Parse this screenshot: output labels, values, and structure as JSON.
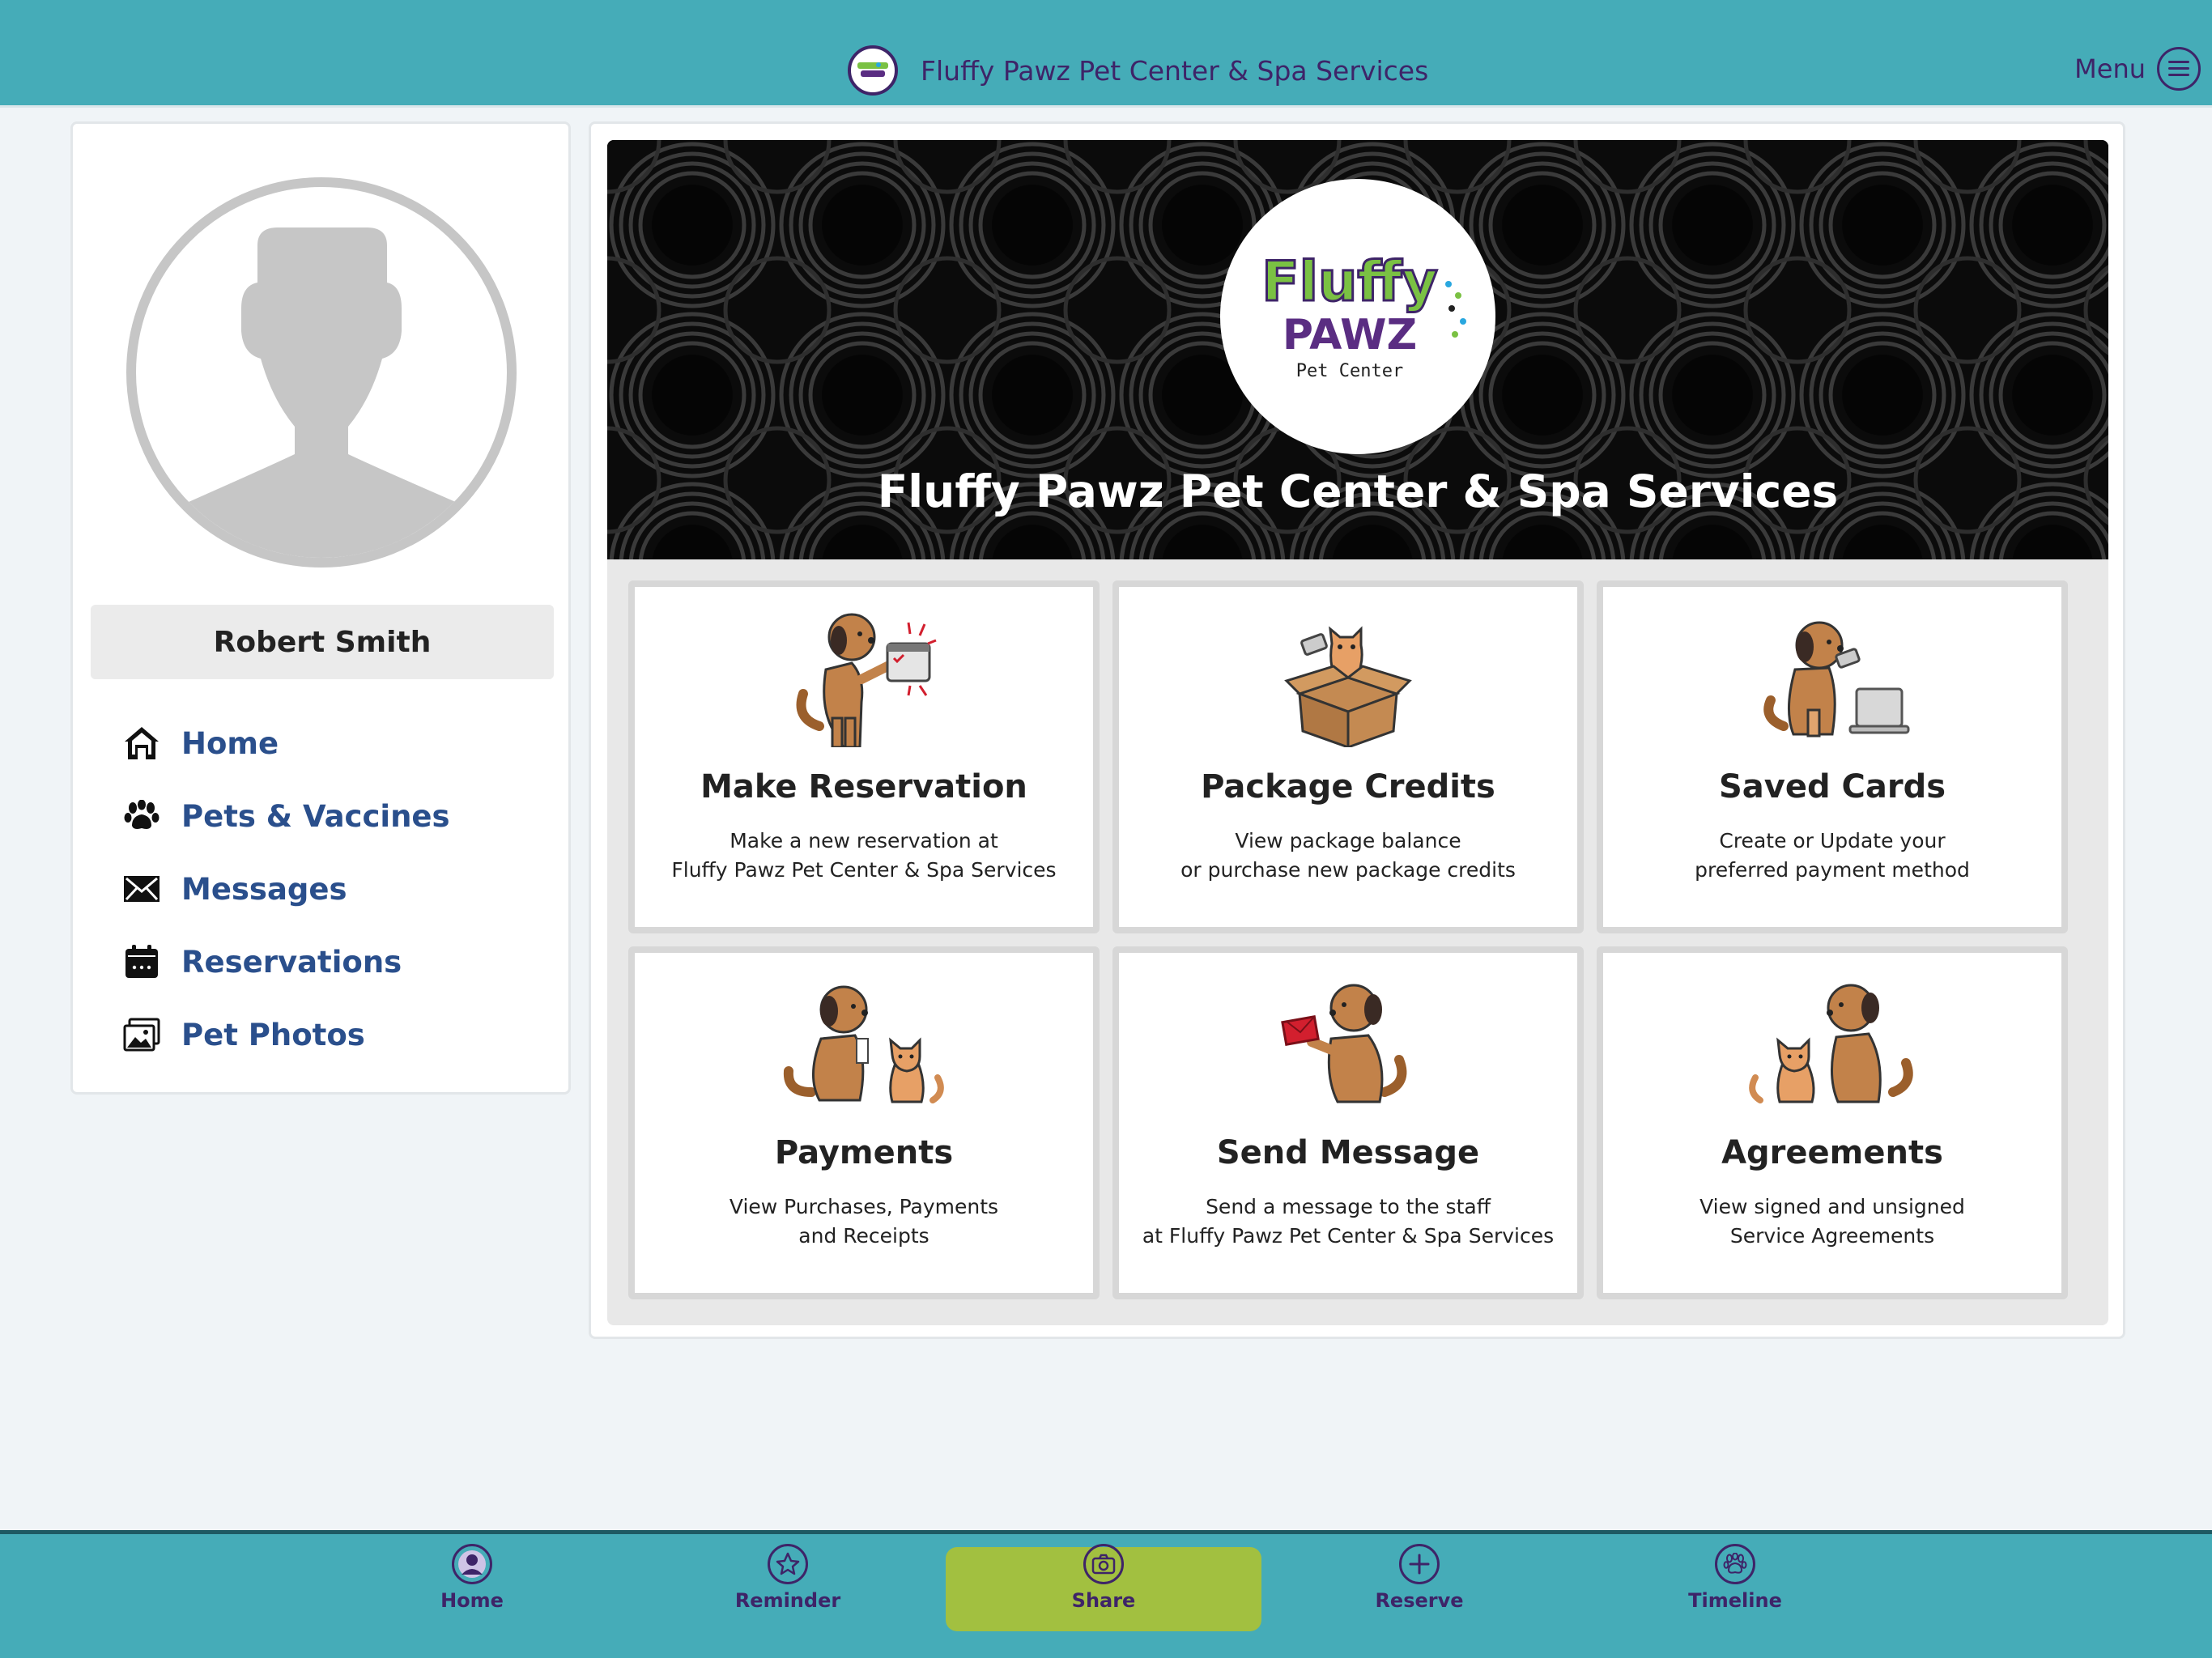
{
  "header": {
    "title": "Fluffy Pawz Pet Center & Spa Services",
    "menu_label": "Menu",
    "logo_icon": "fluffy-pawz-logo"
  },
  "sidebar": {
    "user_name": "Robert Smith",
    "items": [
      {
        "label": "Home",
        "icon": "home-icon"
      },
      {
        "label": "Pets & Vaccines",
        "icon": "paw-icon"
      },
      {
        "label": "Messages",
        "icon": "envelope-icon"
      },
      {
        "label": "Reservations",
        "icon": "calendar-icon"
      },
      {
        "label": "Pet Photos",
        "icon": "photos-icon"
      }
    ]
  },
  "banner": {
    "title": "Fluffy Pawz Pet Center & Spa Services",
    "logo": {
      "line1": "Fluffy",
      "line2": "PAWZ",
      "line3": "Pet Center"
    }
  },
  "tiles": [
    {
      "title": "Make Reservation",
      "line1": "Make a new reservation at",
      "line2": "Fluffy Pawz Pet Center & Spa Services"
    },
    {
      "title": "Package Credits",
      "line1": "View package balance",
      "line2": "or purchase new package credits"
    },
    {
      "title": "Saved Cards",
      "line1": "Create or Update your",
      "line2": "preferred payment method"
    },
    {
      "title": "Payments",
      "line1": "View Purchases, Payments",
      "line2": "and Receipts"
    },
    {
      "title": "Send Message",
      "line1": "Send a message to the staff",
      "line2": "at Fluffy Pawz Pet Center & Spa Services"
    },
    {
      "title": "Agreements",
      "line1": "View signed and unsigned",
      "line2": "Service Agreements"
    }
  ],
  "tabbar": {
    "items": [
      {
        "label": "Home",
        "icon": "user-circle-icon"
      },
      {
        "label": "Reminder",
        "icon": "star-icon"
      },
      {
        "label": "Share",
        "icon": "camera-icon"
      },
      {
        "label": "Reserve",
        "icon": "plus-icon"
      },
      {
        "label": "Timeline",
        "icon": "paw-icon"
      }
    ]
  },
  "colors": {
    "brand_teal": "#45acb8",
    "brand_purple": "#3e2468",
    "nav_link": "#2a4f8c",
    "share_green": "#a2c040"
  }
}
